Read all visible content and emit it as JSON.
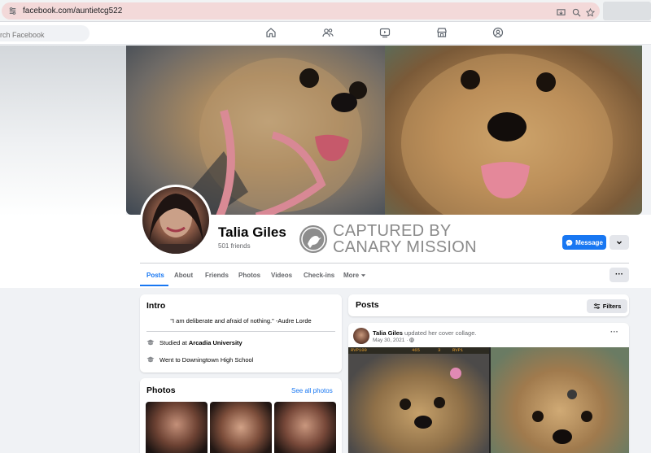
{
  "browser": {
    "url": "facebook.com/auntietcg522"
  },
  "fb_nav": {
    "search_placeholder": "rch Facebook",
    "icons": [
      "home-icon",
      "friends-icon",
      "watch-icon",
      "marketplace-icon",
      "groups-icon"
    ]
  },
  "profile": {
    "name": "Talia Giles",
    "friends": "501 friends",
    "message_label": "Message"
  },
  "watermark": {
    "line1": "CAPTURED BY",
    "line2": "CANARY MISSION"
  },
  "tabs": [
    {
      "label": "Posts",
      "active": true
    },
    {
      "label": "About"
    },
    {
      "label": "Friends"
    },
    {
      "label": "Photos"
    },
    {
      "label": "Videos"
    },
    {
      "label": "Check-ins"
    },
    {
      "label": "More"
    }
  ],
  "tabs_more_button": "···",
  "intro": {
    "title": "Intro",
    "quote": "\"I am deliberate and afraid of nothing.\" -Audre Lorde",
    "studied_prefix": "Studied at ",
    "studied_place": "Arcadia University",
    "went_to": "Went to Downingtown High School"
  },
  "photos": {
    "title": "Photos",
    "see_all": "See all photos"
  },
  "posts": {
    "title": "Posts",
    "filters_label": "Filters",
    "post": {
      "author": "Talia Giles",
      "action": " updated her cover collage.",
      "date": "May 30, 2021 · ",
      "menu": "···",
      "strip_text": [
        "RVP100",
        "465",
        "3",
        "RVP1"
      ]
    }
  },
  "colors": {
    "accent": "#1877f2",
    "omnibox": "#f3d9d9"
  }
}
